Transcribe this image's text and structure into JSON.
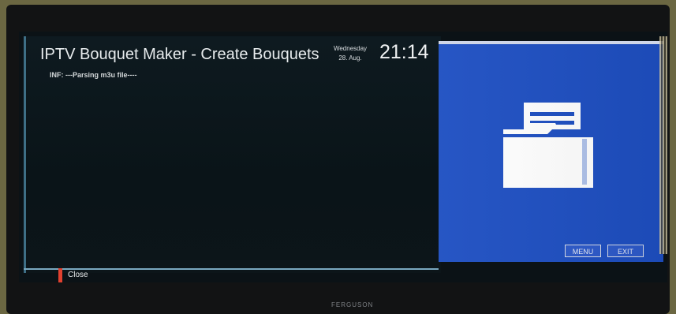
{
  "window": {
    "title": "IPTV Bouquet Maker - Create Bouquets",
    "day": "Wednesday",
    "date": "28. Aug.",
    "time": "21:14"
  },
  "log": {
    "lines": [
      "INF: ---Parsing m3u file----"
    ]
  },
  "footer": {
    "close_label": "Close"
  },
  "side_panel": {
    "menu_label": "MENU",
    "exit_label": "EXIT",
    "icon": "folder-document-icon"
  },
  "device": {
    "brand": "FERGUSON"
  },
  "colors": {
    "accent_blue": "#1e4fc2",
    "red_key": "#e2412f",
    "background": "#0b1216"
  }
}
